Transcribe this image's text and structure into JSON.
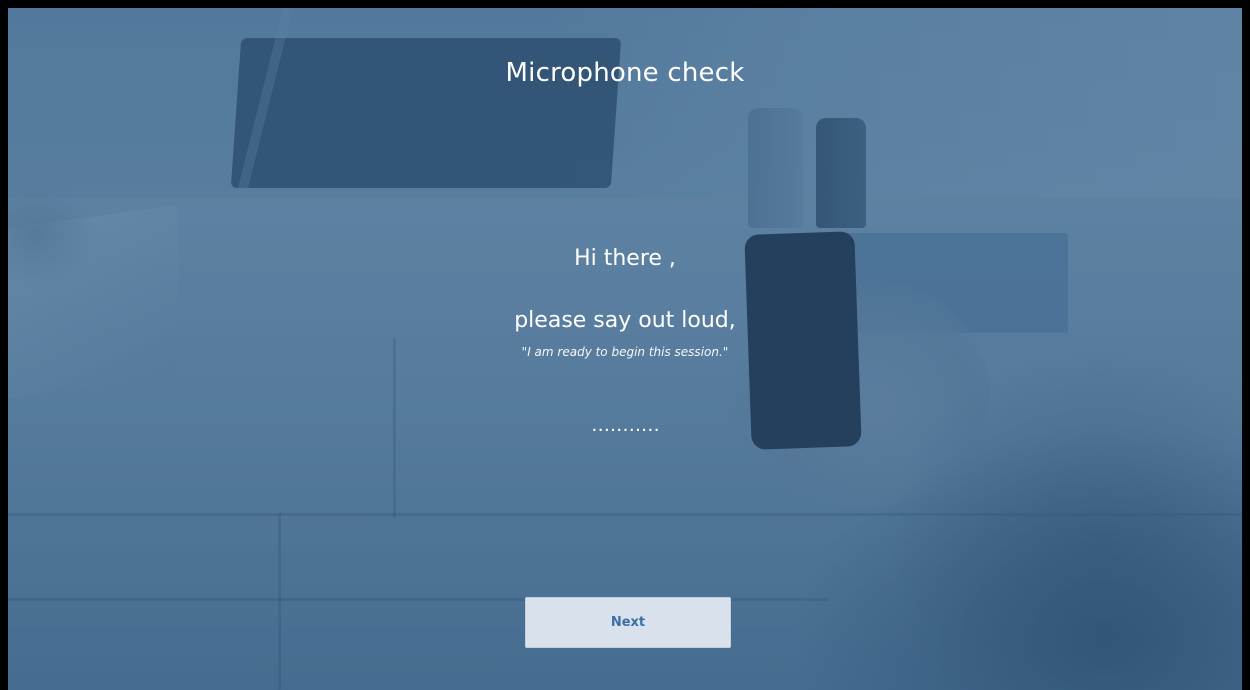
{
  "page": {
    "title": "Microphone check",
    "greeting": "Hi there ,",
    "instruction": "please say out loud,",
    "phrase": "\"I am ready to begin this session.\"",
    "listening_indicator": "...........",
    "next_label": "Next"
  },
  "colors": {
    "overlay": "#2e5680",
    "button_bg": "#d9e2ec",
    "button_text": "#3a6ea8",
    "text": "#ffffff"
  }
}
